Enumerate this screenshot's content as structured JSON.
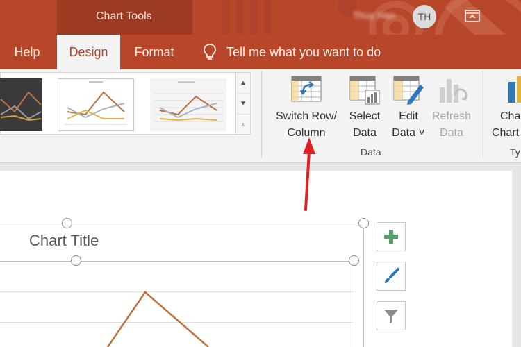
{
  "app": {
    "context_tab_group": "Chart Tools",
    "user_name": "Thuy Han",
    "user_initials": "TH"
  },
  "tabs": [
    {
      "label": "Help"
    },
    {
      "label": "Design",
      "selected": true
    },
    {
      "label": "Format"
    }
  ],
  "tell_me": {
    "text": "Tell me what you want to do"
  },
  "ribbon": {
    "data_group": {
      "label": "Data",
      "buttons": [
        {
          "line1": "Switch Row/",
          "line2": "Column",
          "enabled": true
        },
        {
          "line1": "Select",
          "line2": "Data",
          "enabled": true
        },
        {
          "line1": "Edit",
          "line2": "Data ˅",
          "enabled": true
        },
        {
          "line1": "Refresh",
          "line2": "Data",
          "enabled": false
        }
      ]
    },
    "type_group": {
      "label": "Ty",
      "button": {
        "line1": "Cha",
        "line2": "Chart"
      }
    }
  },
  "chart": {
    "title": "Chart Title"
  },
  "colors": {
    "accent": "#b8472a",
    "annotation_arrow": "#e02020",
    "series_orange": "#c0703c"
  },
  "icons": [
    "bulb-icon",
    "ribbon-display-options-icon",
    "switch-row-column-icon",
    "select-data-icon",
    "edit-data-icon",
    "refresh-data-icon",
    "change-chart-type-icon",
    "chart-elements-plus-icon",
    "chart-styles-brush-icon",
    "chart-filters-funnel-icon"
  ]
}
